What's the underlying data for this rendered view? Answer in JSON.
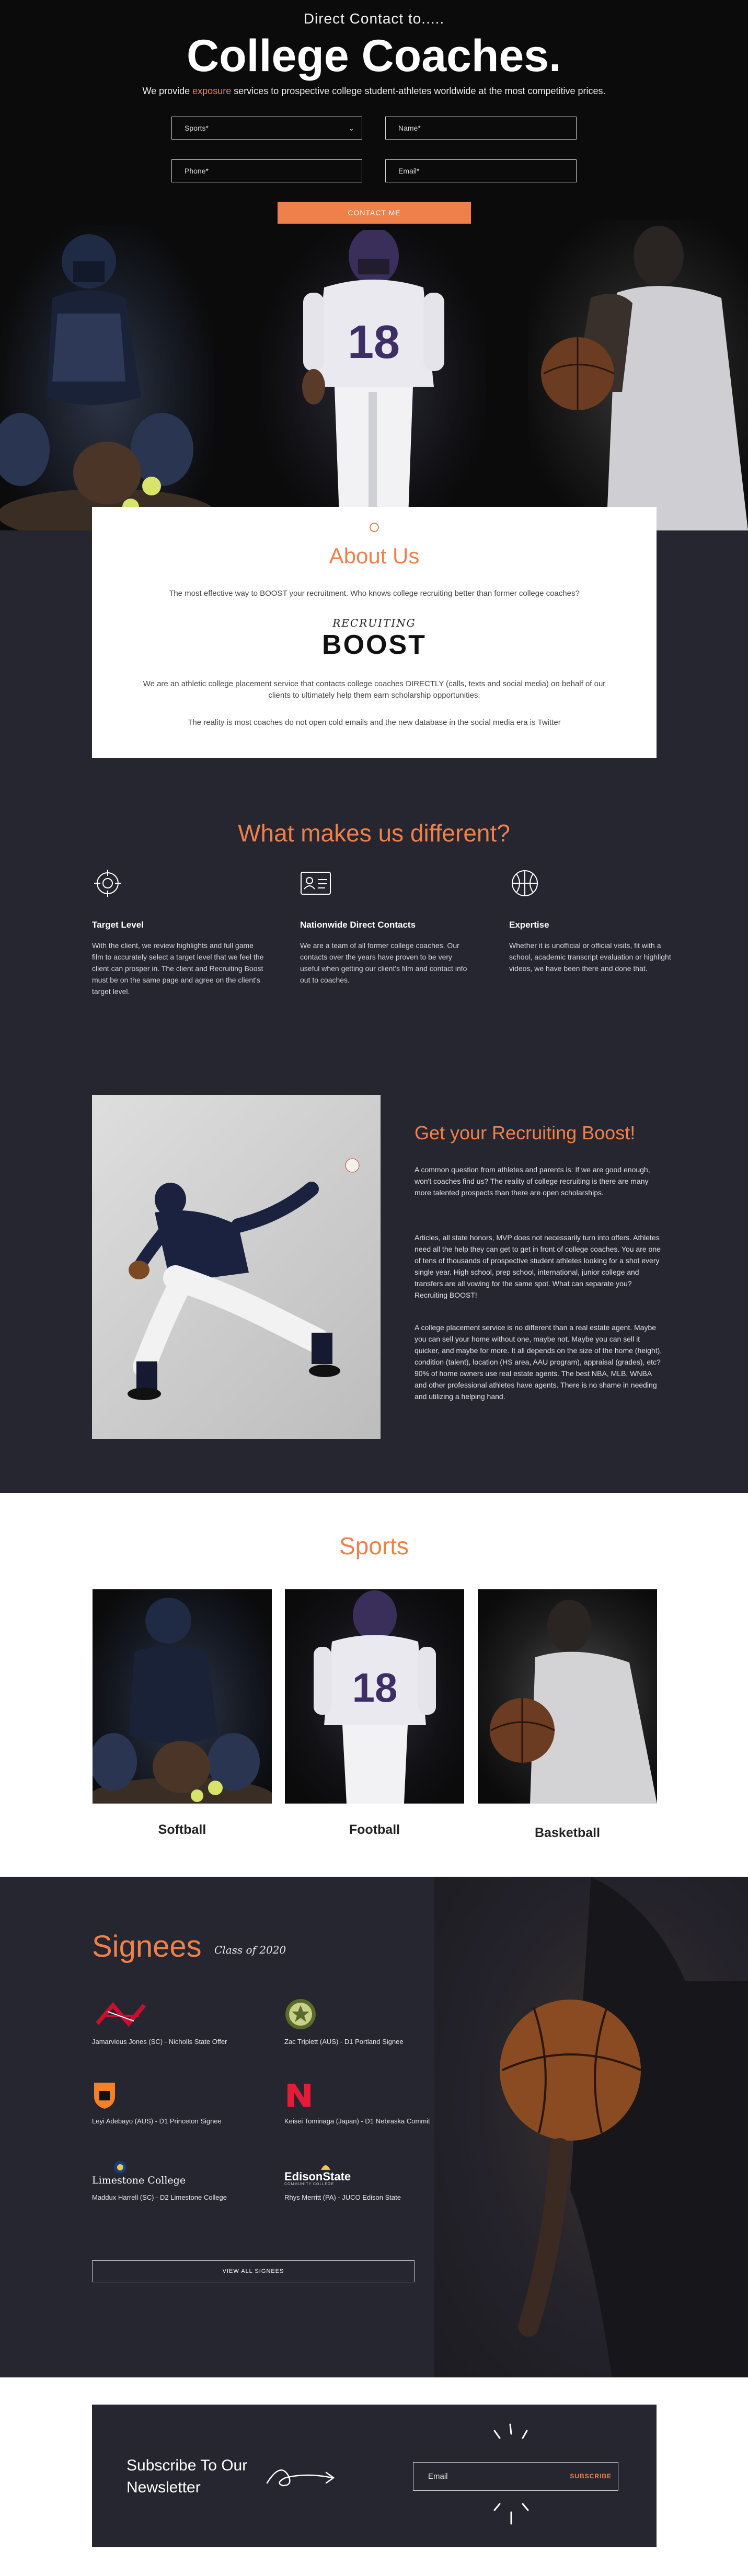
{
  "hero": {
    "pretitle": "Direct Contact to.....",
    "title": "College Coaches.",
    "subtitle_before": "We provide ",
    "subtitle_accent": "exposure",
    "subtitle_after": " services to prospective college student-athletes worldwide at the most competitive prices.",
    "form": {
      "sports_placeholder": "Sports*",
      "name_placeholder": "Name*",
      "phone_placeholder": "Phone*",
      "email_placeholder": "Email*",
      "submit_label": "CONTACT ME"
    }
  },
  "about": {
    "title": "About Us",
    "intro": "The most effective way to BOOST your recruitment. Who knows college recruiting better than former college coaches?",
    "logo_top": "RECRUITING",
    "logo_main": "BOOST",
    "body": "We are an athletic college placement service that contacts college coaches DIRECTLY (calls, texts and social media) on behalf of our clients to ultimately help them earn scholarship opportunities.",
    "footnote": "The reality is most coaches do not open cold emails and the new database in the social media era is Twitter"
  },
  "different": {
    "title": "What makes us different?",
    "features": [
      {
        "icon": "target-icon",
        "title": "Target Level",
        "text": "With the client, we review highlights and full game film to accurately select a target level that we feel the client can prosper in. The client and Recruiting Boost must be on the same page and agree on the client's target level."
      },
      {
        "icon": "id-card-icon",
        "title": "Nationwide Direct Contacts",
        "text": "We are a team of all former college coaches. Our contacts over the years have proven to be very useful when getting our client's film and contact info out to coaches."
      },
      {
        "icon": "basketball-icon",
        "title": "Expertise",
        "text": "Whether it is unofficial or official visits, fit with a school, academic transcript evaluation or highlight videos, we have been there and done that."
      }
    ]
  },
  "boost": {
    "title": "Get your Recruiting Boost!",
    "p1": "A common question from athletes and parents is: If we are good enough, won't coaches find us? The reality of college recruiting is there are many more talented prospects than there are open scholarships.",
    "p2": "Articles, all state honors, MVP does not necessarily turn into offers. Athletes need all the help they can get to get in front of college coaches. You are one of tens of thousands of prospective student athletes looking for a shot every single year. High school, prep school, international, junior college and transfers are all vowing for the same spot. What can separate you? Recruiting BOOST!",
    "p3": "A college placement service is no different than a real estate agent. Maybe you can sell your home without one, maybe not. Maybe you can sell it quicker, and maybe for more. It all depends on the size of the home (height), condition (talent), location (HS area, AAU program), appraisal (grades), etc? 90% of home owners use real estate agents. The best NBA, MLB, WNBA and other professional athletes have agents. There is no shame in needing and utilizing a helping hand."
  },
  "sports": {
    "title": "Sports",
    "items": [
      {
        "label": "Softball"
      },
      {
        "label": "Football"
      },
      {
        "label": "Basketball"
      }
    ]
  },
  "signees": {
    "title": "Signees",
    "class_label": "Class of 2020",
    "items": [
      {
        "logo": "nicholls-logo",
        "caption": "Jamarvious Jones (SC) - Nicholls State Offer"
      },
      {
        "logo": "portland-logo",
        "caption": "Zac Triplett (AUS) - D1 Portland Signee"
      },
      {
        "logo": "princeton-logo",
        "caption": "Leyi Adebayo (AUS) - D1 Princeton Signee"
      },
      {
        "logo": "nebraska-logo",
        "caption": "Keisei Tominaga (Japan) - D1 Nebraska Commit"
      },
      {
        "logo": "limestone-logo",
        "caption": "Maddux Harrell (SC) - D2 Limestone College",
        "logo_text": "Limestone College"
      },
      {
        "logo": "edisonstate-logo",
        "caption": "Rhys Merritt (PA) - JUCO Edison State",
        "logo_text": "EdisonState",
        "logo_sub": "COMMUNITY COLLEGE"
      }
    ],
    "view_all_label": "VIEW ALL SIGNEES"
  },
  "newsletter": {
    "title_line1": "Subscribe To Our",
    "title_line2": "Newsletter",
    "email_placeholder": "Email",
    "subscribe_label": "SUBSCRIBE"
  },
  "colors": {
    "accent": "#f0804a",
    "dark_bg": "#262631",
    "hero_bg": "#0b0b0c"
  }
}
